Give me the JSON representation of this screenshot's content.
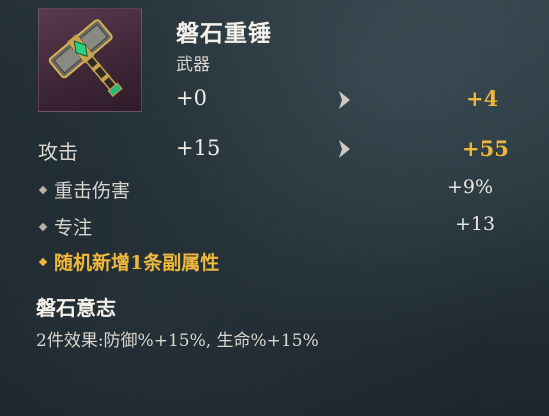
{
  "item": {
    "name": "磐石重锤",
    "type": "武器",
    "icon": "war-hammer-icon",
    "level_current": "+0",
    "level_next": "+4"
  },
  "stats": {
    "main": {
      "label": "攻击",
      "current": "+15",
      "next": "+55"
    },
    "sub": [
      {
        "label": "重击伤害",
        "value": "+9%"
      },
      {
        "label": "专注",
        "value": "+13"
      }
    ],
    "random_line": "随机新增1条副属性"
  },
  "set_bonus": {
    "name": "磐石意志",
    "description": "2件效果:防御%+15%, 生命%+15%"
  },
  "colors": {
    "upgrade": "#f0b83a",
    "icon_bg": "#4a2f41"
  }
}
